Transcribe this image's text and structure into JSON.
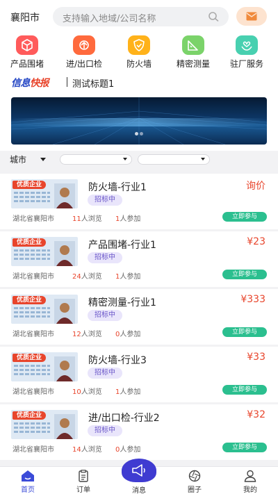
{
  "header": {
    "city": "襄阳市",
    "search_placeholder": "支持输入地域/公司名称"
  },
  "categories": [
    {
      "label": "产品围堵",
      "icon": "box-icon",
      "color": "#ff5b5b"
    },
    {
      "label": "进/出口检",
      "icon": "transport-icon",
      "color": "#ff6a3d"
    },
    {
      "label": "防火墙",
      "icon": "shield-icon",
      "color": "#ffb21a"
    },
    {
      "label": "精密测量",
      "icon": "ruler-icon",
      "color": "#7bd36a"
    },
    {
      "label": "驻厂服务",
      "icon": "heart-hands-icon",
      "color": "#48d0b0"
    }
  ],
  "news": {
    "logo_part1": "信息",
    "logo_part2": "快报",
    "title": "测试标题1"
  },
  "filters": {
    "city_label": "城市"
  },
  "listings": [
    {
      "title": "防火墙-行业1",
      "price": "询价",
      "tag": "招标中",
      "location": "湖北省襄阳市",
      "views": "11",
      "views_suffix": "人浏览",
      "joins": "1",
      "joins_suffix": "人参加",
      "button": "立即参与",
      "badge": "优质企业"
    },
    {
      "title": "产品围堵-行业1",
      "price": "¥23",
      "tag": "招标中",
      "location": "湖北省襄阳市",
      "views": "24",
      "views_suffix": "人浏览",
      "joins": "1",
      "joins_suffix": "人参加",
      "button": "立即参与",
      "badge": "优质企业"
    },
    {
      "title": "精密测量-行业1",
      "price": "¥333",
      "tag": "招标中",
      "location": "湖北省襄阳市",
      "views": "12",
      "views_suffix": "人浏览",
      "joins": "0",
      "joins_suffix": "人参加",
      "button": "立即参与",
      "badge": "优质企业"
    },
    {
      "title": "防火墙-行业3",
      "price": "¥33",
      "tag": "招标中",
      "location": "湖北省襄阳市",
      "views": "10",
      "views_suffix": "人浏览",
      "joins": "1",
      "joins_suffix": "人参加",
      "button": "立即参与",
      "badge": "优质企业"
    },
    {
      "title": "进/出口检-行业2",
      "price": "¥32",
      "tag": "招标中",
      "location": "湖北省襄阳市",
      "views": "14",
      "views_suffix": "人浏览",
      "joins": "0",
      "joins_suffix": "人参加",
      "button": "立即参与",
      "badge": "优质企业"
    }
  ],
  "tabs": [
    {
      "label": "首页",
      "icon": "home-icon",
      "active": true
    },
    {
      "label": "订单",
      "icon": "clipboard-icon",
      "active": false
    },
    {
      "label": "消息",
      "icon": "megaphone-icon",
      "active": false
    },
    {
      "label": "圈子",
      "icon": "aperture-icon",
      "active": false
    },
    {
      "label": "我的",
      "icon": "user-icon",
      "active": false
    }
  ],
  "colors": {
    "accent": "#3b4bd8",
    "price": "#e8452c",
    "join_button": "#2bbf8f",
    "tag_text": "#6a56c9"
  }
}
